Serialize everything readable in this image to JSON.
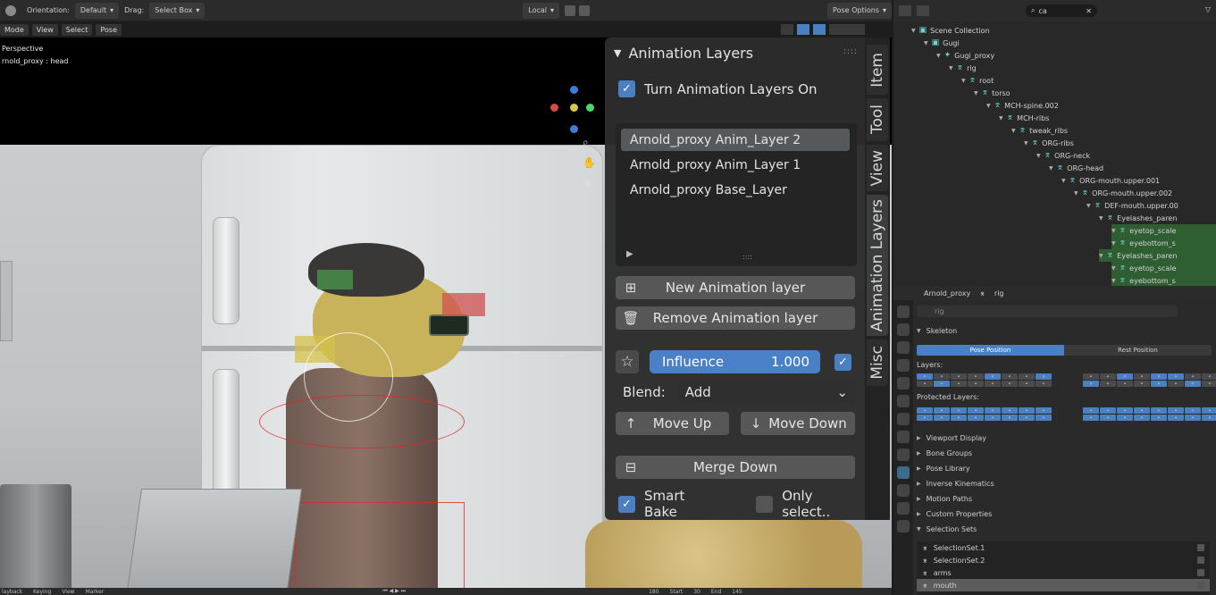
{
  "header": {
    "mode": "Mode",
    "orientation_label": "Orientation:",
    "orientation_value": "Default",
    "drag_label": "Drag:",
    "drag_value": "Select Box",
    "transform_space": "Local",
    "pose_options": "Pose Options"
  },
  "viewport_menu": {
    "mode": "Mode",
    "view": "View",
    "select": "Select",
    "pose": "Pose"
  },
  "viewport_info": {
    "line1": "Perspective",
    "line2": "rnold_proxy : head"
  },
  "sidebar_tabs": [
    "Item",
    "Tool",
    "View",
    "Animation Layers",
    "Misc"
  ],
  "anim_panel": {
    "title": "Animation Layers",
    "toggle_label": "Turn Animation Layers On",
    "toggle_checked": true,
    "layers": [
      "Arnold_proxy Anim_Layer 2",
      "Arnold_proxy Anim_Layer 1",
      "Arnold_proxy Base_Layer"
    ],
    "selected_layer_index": 0,
    "new_layer_label": "New Animation layer",
    "remove_layer_label": "Remove Animation layer",
    "influence_label": "Influence",
    "influence_value": "1.000",
    "influence_checked": true,
    "blend_label": "Blend:",
    "blend_value": "Add",
    "move_up_label": "Move Up",
    "move_down_label": "Move Down",
    "merge_down_label": "Merge Down",
    "smart_bake_label": "Smart Bake",
    "smart_bake_checked": true,
    "only_selected_label": "Only select..",
    "only_selected_checked": false
  },
  "outliner": {
    "search_value": "ca",
    "rows": [
      {
        "label": "Scene Collection",
        "indent": 0,
        "icon": "collection-icon",
        "green": false
      },
      {
        "label": "Gugi",
        "indent": 1,
        "icon": "collection-icon",
        "green": false
      },
      {
        "label": "Gugi_proxy",
        "indent": 2,
        "icon": "armature-icon",
        "green": false
      },
      {
        "label": "rig",
        "indent": 3,
        "icon": "armature-data-icon",
        "green": false
      },
      {
        "label": "root",
        "indent": 4,
        "icon": "bone-icon",
        "green": false
      },
      {
        "label": "torso",
        "indent": 5,
        "icon": "bone-icon",
        "green": false
      },
      {
        "label": "MCH-spine.002",
        "indent": 6,
        "icon": "bone-icon",
        "green": false
      },
      {
        "label": "MCH-ribs",
        "indent": 7,
        "icon": "bone-icon",
        "green": false
      },
      {
        "label": "tweak_ribs",
        "indent": 8,
        "icon": "bone-icon",
        "green": false
      },
      {
        "label": "ORG-ribs",
        "indent": 9,
        "icon": "bone-icon",
        "green": false
      },
      {
        "label": "ORG-neck",
        "indent": 10,
        "icon": "bone-icon",
        "green": false
      },
      {
        "label": "ORG-head",
        "indent": 11,
        "icon": "bone-icon",
        "green": false
      },
      {
        "label": "ORG-mouth.upper.001",
        "indent": 12,
        "icon": "bone-icon",
        "green": false
      },
      {
        "label": "ORG-mouth.upper.002",
        "indent": 13,
        "icon": "bone-icon",
        "green": false
      },
      {
        "label": "DEF-mouth.upper.00",
        "indent": 14,
        "icon": "bone-icon",
        "green": false
      },
      {
        "label": "Eyelashes_paren",
        "indent": 15,
        "icon": "bone-icon",
        "green": false
      },
      {
        "label": "eyetop_scale",
        "indent": 16,
        "icon": "bone-icon",
        "green": true
      },
      {
        "label": "eyebottom_s",
        "indent": 16,
        "icon": "bone-icon",
        "green": true
      },
      {
        "label": "Eyelashes_paren",
        "indent": 15,
        "icon": "bone-icon",
        "green": true
      },
      {
        "label": "eyetop_scale",
        "indent": 16,
        "icon": "bone-icon",
        "green": true
      },
      {
        "label": "eyebottom_s",
        "indent": 16,
        "icon": "bone-icon",
        "green": true
      }
    ]
  },
  "properties": {
    "object_name": "Arnold_proxy",
    "data_name": "rig",
    "search_placeholder": "rig",
    "skeleton_label": "Skeleton",
    "pose_position": "Pose Position",
    "rest_position": "Rest Position",
    "layers_label": "Layers:",
    "protected_layers_label": "Protected Layers:",
    "sections": [
      "Viewport Display",
      "Bone Groups",
      "Pose Library",
      "Inverse Kinematics",
      "Motion Paths",
      "Custom Properties",
      "Selection Sets"
    ],
    "selection_sets": [
      "SelectionSet.1",
      "SelectionSet.2",
      "arms",
      "mouth"
    ]
  },
  "timeline": {
    "playback": "layback",
    "keying": "Keying",
    "view": "View",
    "marker": "Marker",
    "frame": "180",
    "start_label": "Start",
    "start_value": "30",
    "end_label": "End",
    "end_value": "145"
  },
  "colors": {
    "accent": "#4a7fc1",
    "green_highlight": "#2e5e31",
    "panel_bg": "#2c2c2c"
  }
}
